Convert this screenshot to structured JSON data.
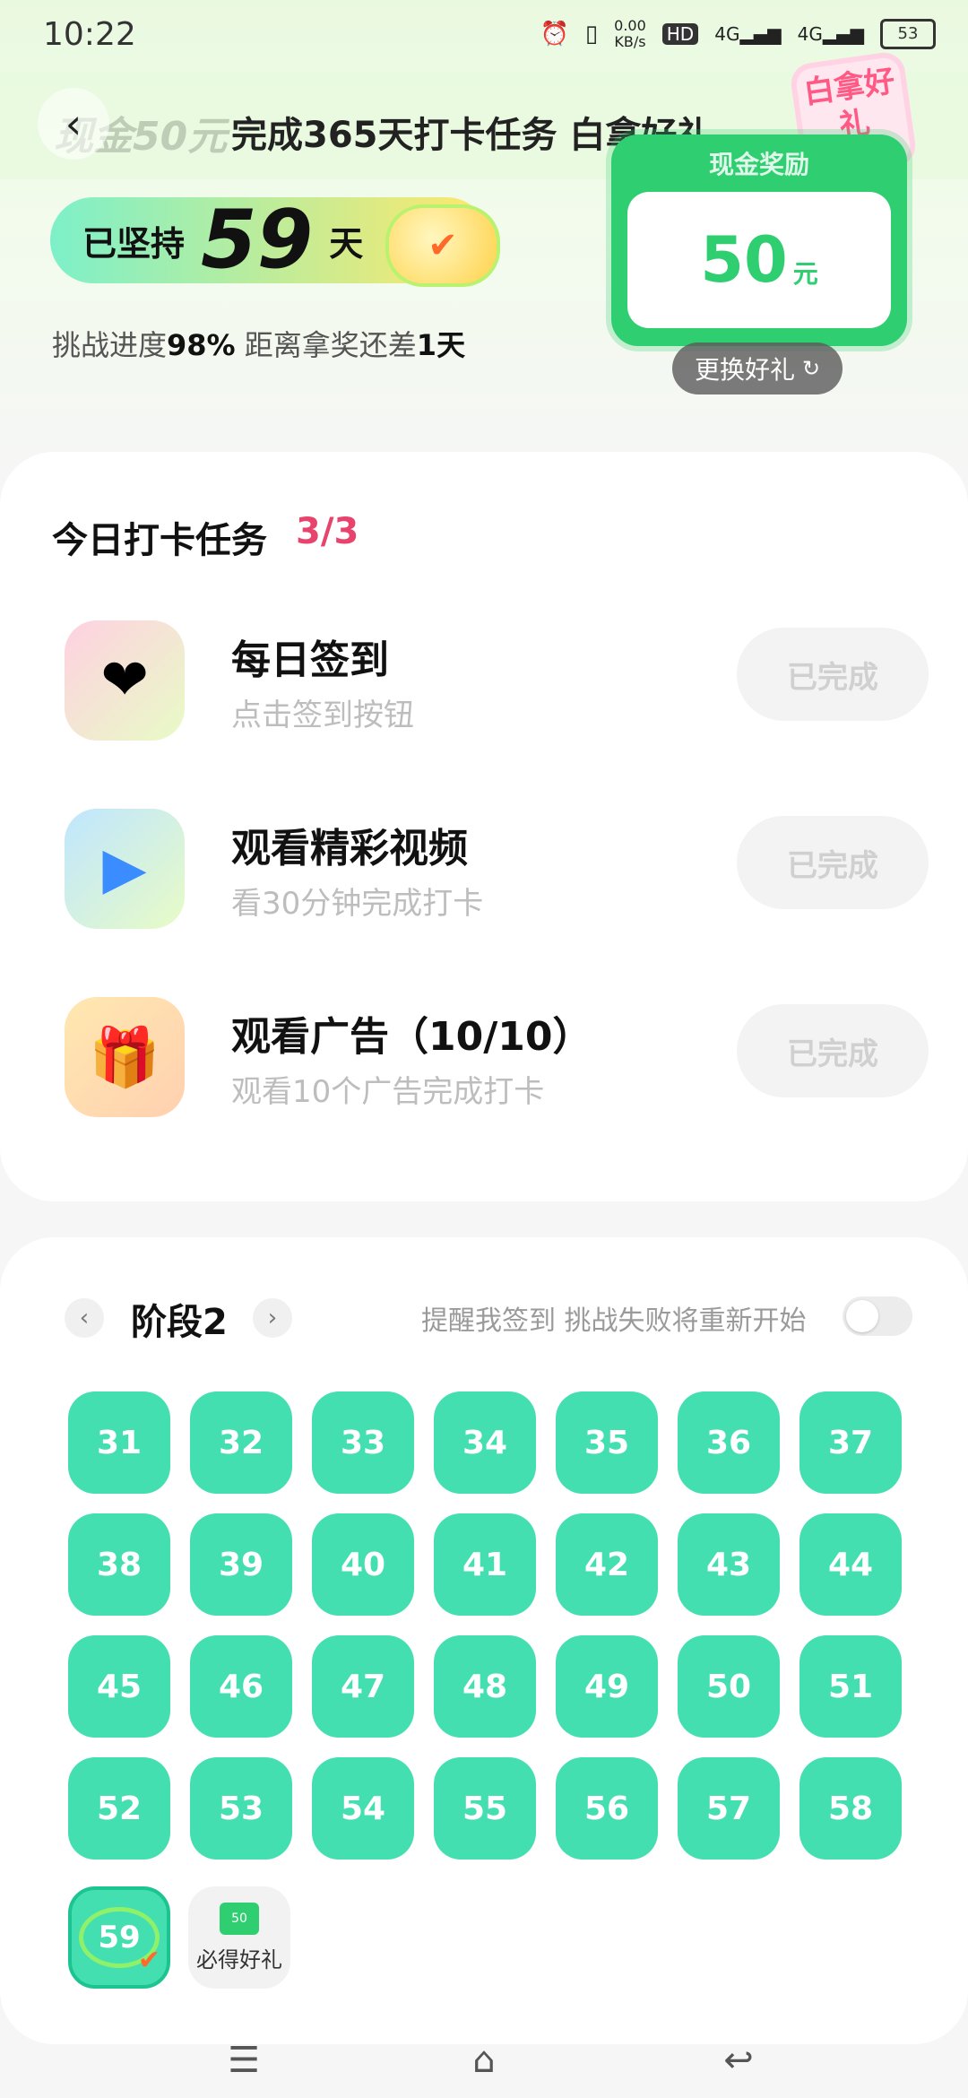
{
  "status_bar": {
    "time": "10:22",
    "network_speed": "0.00",
    "network_speed_unit": "KB/s",
    "hd_label": "HD",
    "net1": "4G",
    "net2": "4G",
    "battery": "53"
  },
  "header": {
    "ghost_title": "现金50元",
    "title": "完成365天打卡任务 白拿好礼",
    "sticker": "白拿好礼"
  },
  "streak": {
    "prefix": "已坚持",
    "days": "59",
    "suffix": "天"
  },
  "progress": {
    "label": "挑战进度",
    "percent": "98%",
    "middle": " 距离拿奖还差",
    "remaining": "1天"
  },
  "reward": {
    "label": "现金奖励",
    "amount": "50",
    "unit": "元",
    "change_label": "更换好礼"
  },
  "tasks": {
    "title": "今日打卡任务",
    "count": "3/3",
    "items": [
      {
        "name": "每日签到",
        "desc": "点击签到按钮",
        "button": "已完成",
        "icon": "calendar-heart-icon"
      },
      {
        "name": "观看精彩视频",
        "desc": "看30分钟完成打卡",
        "button": "已完成",
        "icon": "video-play-icon"
      },
      {
        "name": "观看广告（10/10）",
        "desc": "观看10个广告完成打卡",
        "button": "已完成",
        "icon": "gift-box-icon"
      }
    ]
  },
  "calendar": {
    "stage": "阶段2",
    "prev": "‹",
    "next": "›",
    "remind": "提醒我签到 挑战失败将重新开始",
    "days": [
      "31",
      "32",
      "33",
      "34",
      "35",
      "36",
      "37",
      "38",
      "39",
      "40",
      "41",
      "42",
      "43",
      "44",
      "45",
      "46",
      "47",
      "48",
      "49",
      "50",
      "51",
      "52",
      "53",
      "54",
      "55",
      "56",
      "57",
      "58"
    ],
    "today": "59",
    "gift_label": "必得好礼",
    "gift_mini": "50"
  },
  "colors": {
    "accent_green": "#43dfb1",
    "reward_green": "#2fce71",
    "task_count_pink": "#e8436c"
  }
}
